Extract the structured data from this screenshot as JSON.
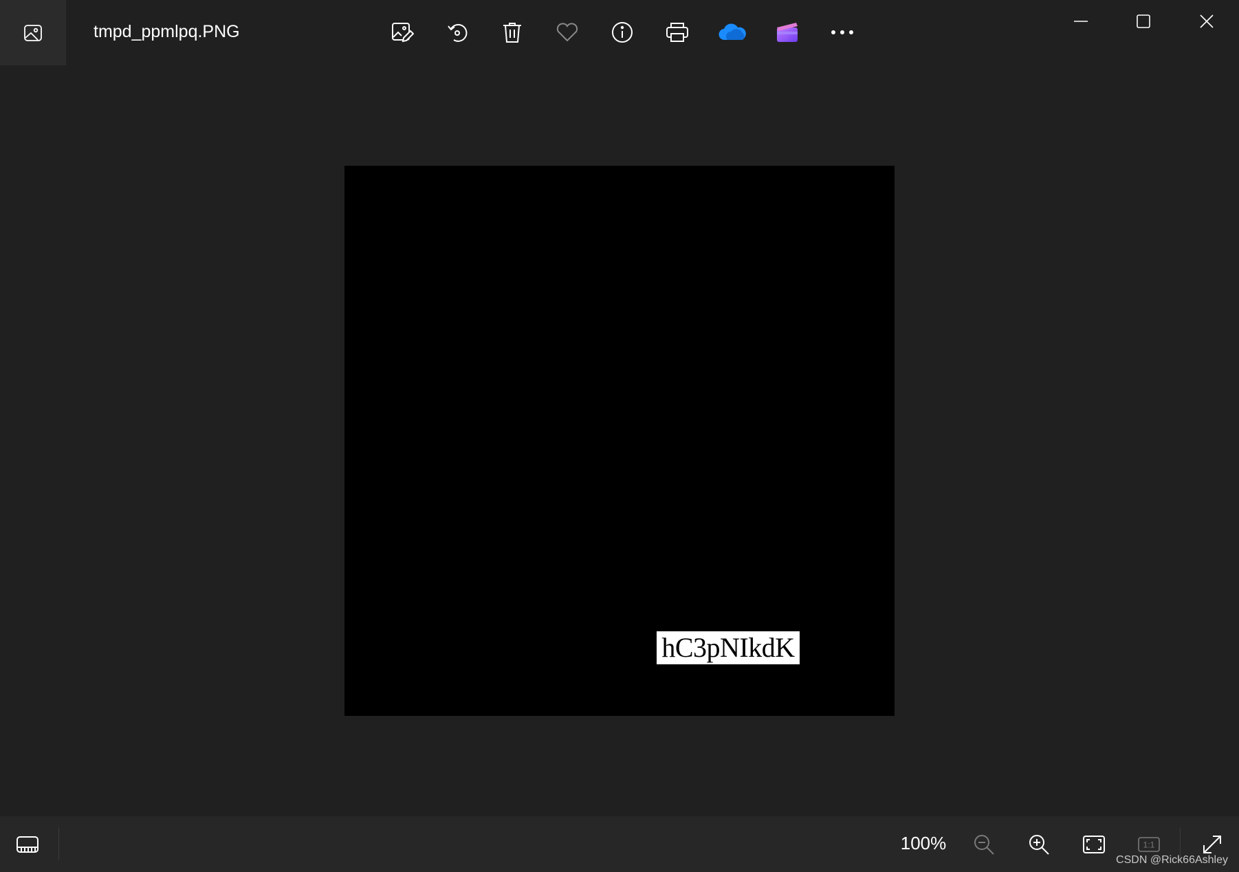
{
  "titlebar": {
    "filename": "tmpd_ppmlpq.PNG",
    "app_icon": "photos-app-icon"
  },
  "toolbar": {
    "items": [
      {
        "name": "edit-image",
        "icon": "edit-image-icon"
      },
      {
        "name": "rotate",
        "icon": "rotate-icon"
      },
      {
        "name": "delete",
        "icon": "trash-icon"
      },
      {
        "name": "favorite",
        "icon": "heart-icon"
      },
      {
        "name": "info",
        "icon": "info-icon"
      },
      {
        "name": "print",
        "icon": "printer-icon"
      },
      {
        "name": "onedrive",
        "icon": "onedrive-cloud-icon"
      },
      {
        "name": "clipchamp",
        "icon": "clipchamp-icon"
      },
      {
        "name": "more",
        "icon": "more-horizontal-icon"
      }
    ]
  },
  "window_controls": {
    "minimize": "minimize-icon",
    "maximize": "maximize-icon",
    "close": "close-icon"
  },
  "image": {
    "overlay_text": "hC3pNIkdK",
    "background": "#000000"
  },
  "bottombar": {
    "filmstrip_icon": "filmstrip-icon",
    "zoom_level": "100%",
    "zoom_out_icon": "zoom-out-icon",
    "zoom_in_icon": "zoom-in-icon",
    "fit_icon": "fit-to-window-icon",
    "actual_size_icon": "actual-size-icon",
    "actual_size_label": "1:1",
    "fullscreen_icon": "fullscreen-icon"
  },
  "watermark": "CSDN @Rick66Ashley",
  "colors": {
    "background": "#202020",
    "bottombar": "#272727",
    "accent_onedrive": "#1a8cff",
    "accent_clipchamp": "#8b5cf6"
  }
}
